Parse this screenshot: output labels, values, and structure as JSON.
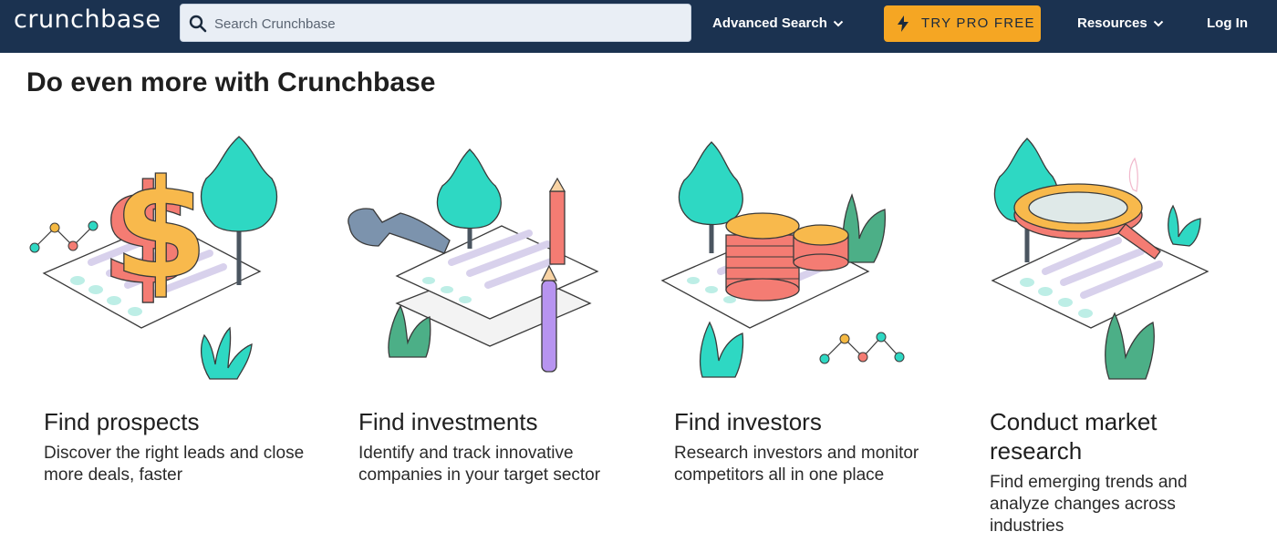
{
  "header": {
    "logo": "crunchbase",
    "search_placeholder": "Search Crunchbase",
    "advanced_search": "Advanced Search",
    "try_pro": "TRY PRO FREE",
    "resources": "Resources",
    "login": "Log In"
  },
  "main": {
    "heading": "Do even more with Crunchbase",
    "cards": [
      {
        "title": "Find prospects",
        "desc": "Discover the right leads and close more deals, faster",
        "icon": "dollar-sign-icon"
      },
      {
        "title": "Find investments",
        "desc": "Identify and track innovative companies in your target sector",
        "icon": "wrench-icon"
      },
      {
        "title": "Find investors",
        "desc": "Research investors and monitor competitors all in one place",
        "icon": "coins-icon"
      },
      {
        "title": "Conduct market research",
        "desc": "Find emerging trends and analyze changes across industries",
        "icon": "magnifier-icon"
      }
    ]
  },
  "colors": {
    "header_bg": "#1b3250",
    "accent": "#f5a623",
    "teal": "#2ed8c3",
    "coral": "#f47c73",
    "purple": "#cfc4ea"
  }
}
